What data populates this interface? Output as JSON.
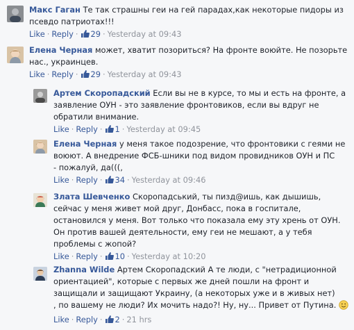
{
  "comments": [
    {
      "author": "Макс Гаган",
      "text": "Те так страшны геи на гей парадах,как некоторые пидоры из\nпсевдо патриотах!!!",
      "like_label": "Like",
      "reply_label": "Reply",
      "likes": "29",
      "time": "Yesterday at 09:43"
    },
    {
      "author": "Елена Черная",
      "text": "может, хватит позориться? На фронте воюйте. Не позорьте\nнас., украинцев.",
      "like_label": "Like",
      "reply_label": "Reply",
      "likes": "29",
      "time": "Yesterday at 09:43"
    }
  ],
  "replies": [
    {
      "author": "Артем Скоропадский",
      "text": "Если вы не в курсе, то мы и есть на фронте, а\nзаявление ОУН - это заявление фронтовиков, если вы вдруг не\nобратили внимание.",
      "like_label": "Like",
      "reply_label": "Reply",
      "likes": "1",
      "time": "Yesterday at 09:45"
    },
    {
      "author": "Елена Черная",
      "text": "у меня такое подозрение, что фронтовики с геями не\nвоюют. А внедрение ФСБ-шники под видом провидников ОУН и ПС\n- пожалуй, да(((,",
      "like_label": "Like",
      "reply_label": "Reply",
      "likes": "34",
      "time": "Yesterday at 09:46"
    },
    {
      "author": "Злата Шевченко",
      "text": "Скоропадський, ты пизд@ишь, как дышишь,\nсейчас у меня живет мой друг, Донбасс, пока в госпитале,\nостановился у меня. Вот только что показала ему эту хрень от ОУН.\nОн против вашей деятельности, ему геи не мешают, а у тебя\nпроблемы с жопой?",
      "like_label": "Like",
      "reply_label": "Reply",
      "likes": "10",
      "time": "Yesterday at 10:20"
    },
    {
      "author": "Zhanna Wilde",
      "text": "Артем Скоропадский А те люди, с \"нетрадиционной\nориентацией\", которые с первых же дней пошли на фронт и\nзащищали и защищают Украину, (а некоторых уже и в живых нет)\n, по вашему не люди? Их мочить надо?! Ну, ну... Привет от Путина.",
      "like_label": "Like",
      "reply_label": "Reply",
      "likes": "2",
      "time": "21 hrs"
    }
  ],
  "icons": {
    "like": "thumbs-up-icon",
    "emoji": "smiley-emoji-icon"
  },
  "colors": {
    "link": "#365899",
    "meta": "#90949c",
    "background": "#f6f7f9",
    "thread_line": "#dddfe2"
  }
}
